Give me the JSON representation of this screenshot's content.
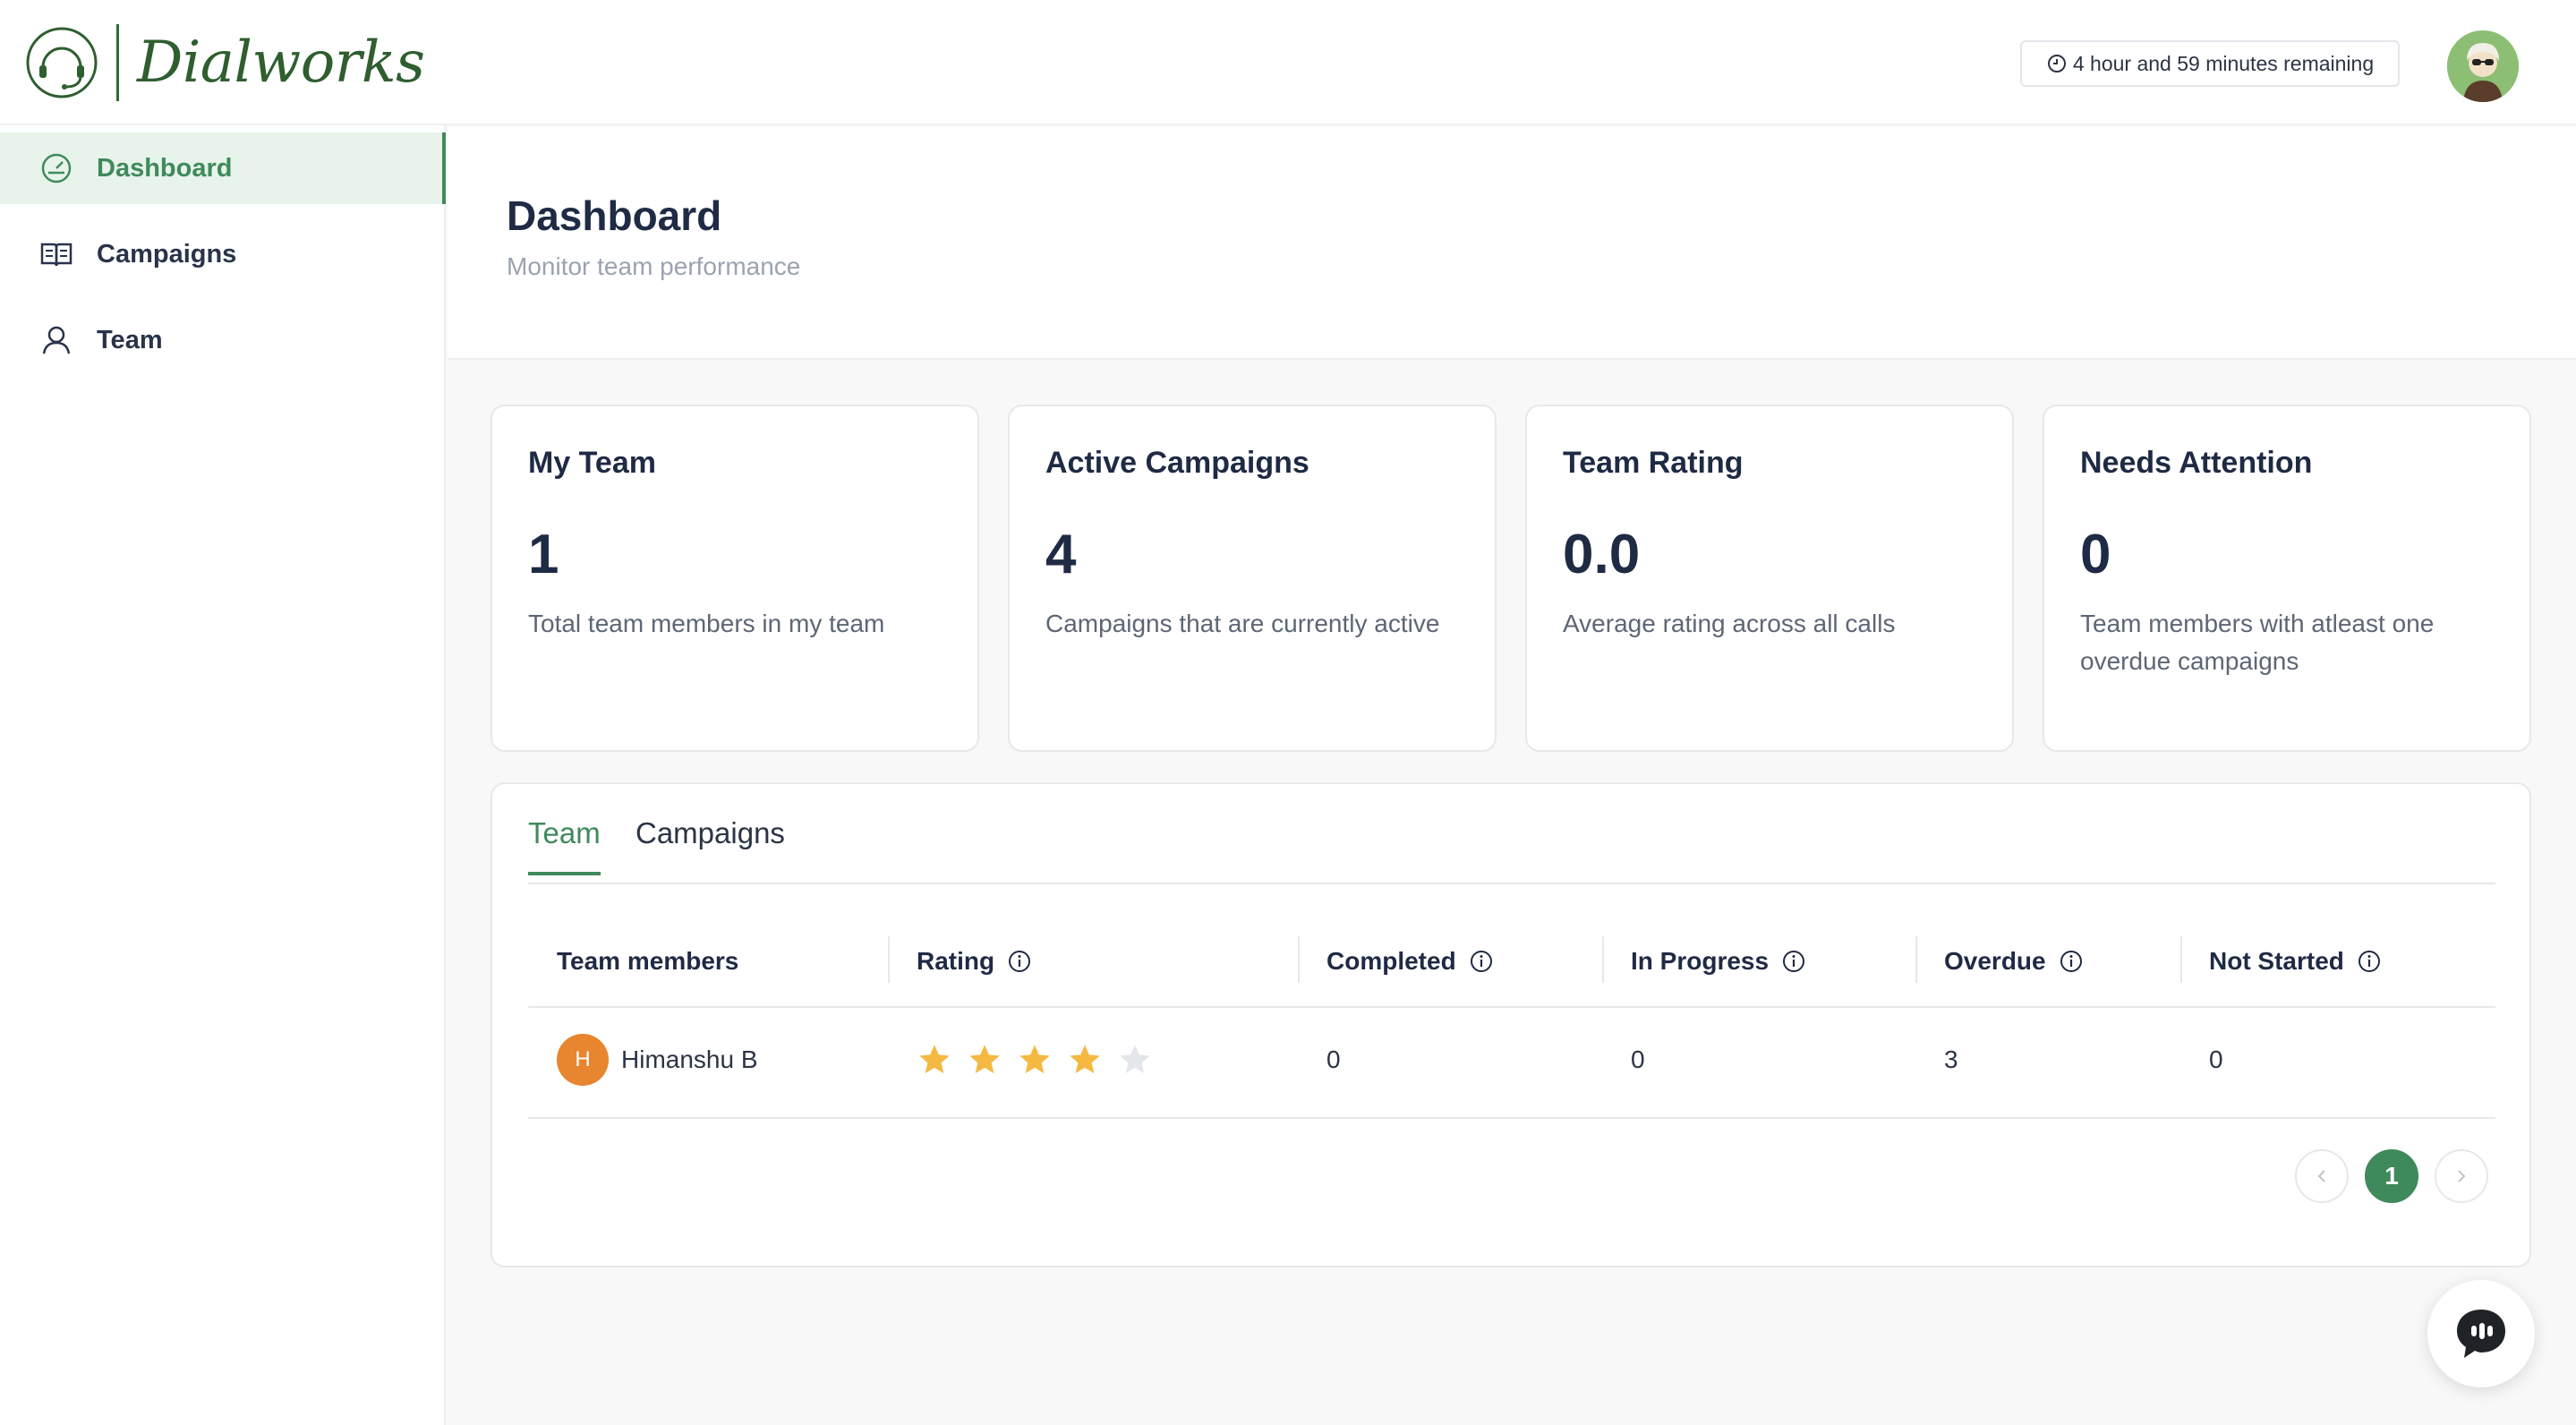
{
  "brand": {
    "name": "Dialworks",
    "color": "#2f5e2f",
    "accent": "#3f8a5a"
  },
  "header": {
    "timer_text": "4 hour and 59 minutes remaining",
    "timer_icon": "clock-icon",
    "avatar_icon": "user-avatar"
  },
  "sidebar": {
    "items": [
      {
        "label": "Dashboard",
        "icon": "dashboard-gauge-icon",
        "active": true
      },
      {
        "label": "Campaigns",
        "icon": "book-icon",
        "active": false
      },
      {
        "label": "Team",
        "icon": "user-icon",
        "active": false
      }
    ]
  },
  "page": {
    "title": "Dashboard",
    "subtitle": "Monitor team performance"
  },
  "cards": [
    {
      "title": "My Team",
      "value": "1",
      "desc": "Total team members in my team"
    },
    {
      "title": "Active Campaigns",
      "value": "4",
      "desc": "Campaigns that are currently active"
    },
    {
      "title": "Team Rating",
      "value": "0.0",
      "desc": "Average rating across all calls"
    },
    {
      "title": "Needs Attention",
      "value": "0",
      "desc": "Team members with atleast one overdue campaigns"
    }
  ],
  "tabs": [
    {
      "label": "Team",
      "active": true
    },
    {
      "label": "Campaigns",
      "active": false
    }
  ],
  "table": {
    "columns": [
      "Team members",
      "Rating",
      "Completed",
      "In Progress",
      "Overdue",
      "Not Started"
    ],
    "rows": [
      {
        "initial": "H",
        "name": "Himanshu B",
        "rating": 4,
        "rating_max": 5,
        "completed": "0",
        "in_progress": "0",
        "overdue": "3",
        "not_started": "0"
      }
    ]
  },
  "pagination": {
    "current": "1"
  },
  "colors": {
    "star_filled": "#f5b942",
    "star_empty": "#e3e6ea",
    "avatar_orange": "#e8852f"
  }
}
